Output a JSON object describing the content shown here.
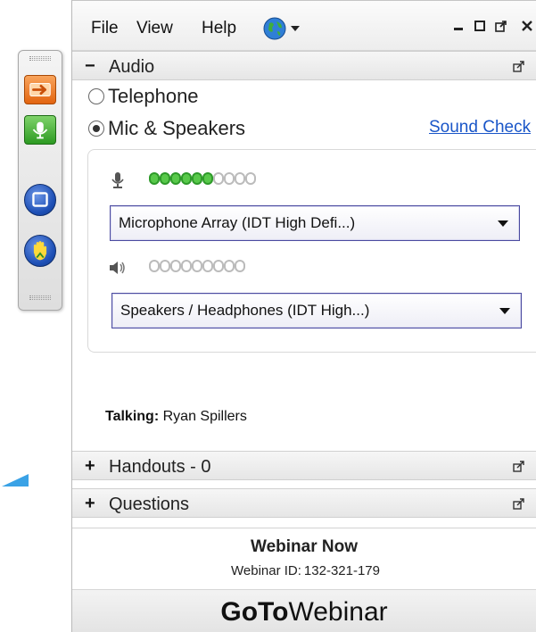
{
  "menu": {
    "file": "File",
    "view": "View",
    "help": "Help"
  },
  "audio": {
    "title": "Audio",
    "telephone_label": "Telephone",
    "mic_label": "Mic & Speakers",
    "selected_mode": "Mic & Speakers",
    "sound_check": "Sound Check",
    "mic_level": 6,
    "mic_meter_segments": 10,
    "speaker_level": 0,
    "speaker_meter_segments": 9,
    "mic_device": "Microphone Array (IDT High Defi...)",
    "speaker_device": "Speakers / Headphones (IDT High...)",
    "talking_label": "Talking:",
    "talking_name": "Ryan Spillers"
  },
  "handouts": {
    "title": "Handouts - 0"
  },
  "questions": {
    "title": "Questions"
  },
  "webinar": {
    "name": "Webinar Now",
    "id_label": "Webinar ID:",
    "id_value": "132-321-179"
  },
  "brand": {
    "part1": "GoTo",
    "part2": "Webinar"
  },
  "colors": {
    "link": "#1a56c8",
    "meter_on": "#58c94a",
    "toolbar_orange": "#e26410",
    "toolbar_green": "#2c9a22",
    "toolbar_blue": "#1d4fb5",
    "pointer": "#3aa2e6"
  },
  "icons": {
    "toolbar": [
      "arrow-right-icon",
      "microphone-icon",
      "screen-icon",
      "raise-hand-icon"
    ],
    "menu": [
      "globe-icon"
    ],
    "window": [
      "minimize-icon",
      "maximize-icon",
      "popout-icon",
      "close-icon"
    ]
  }
}
